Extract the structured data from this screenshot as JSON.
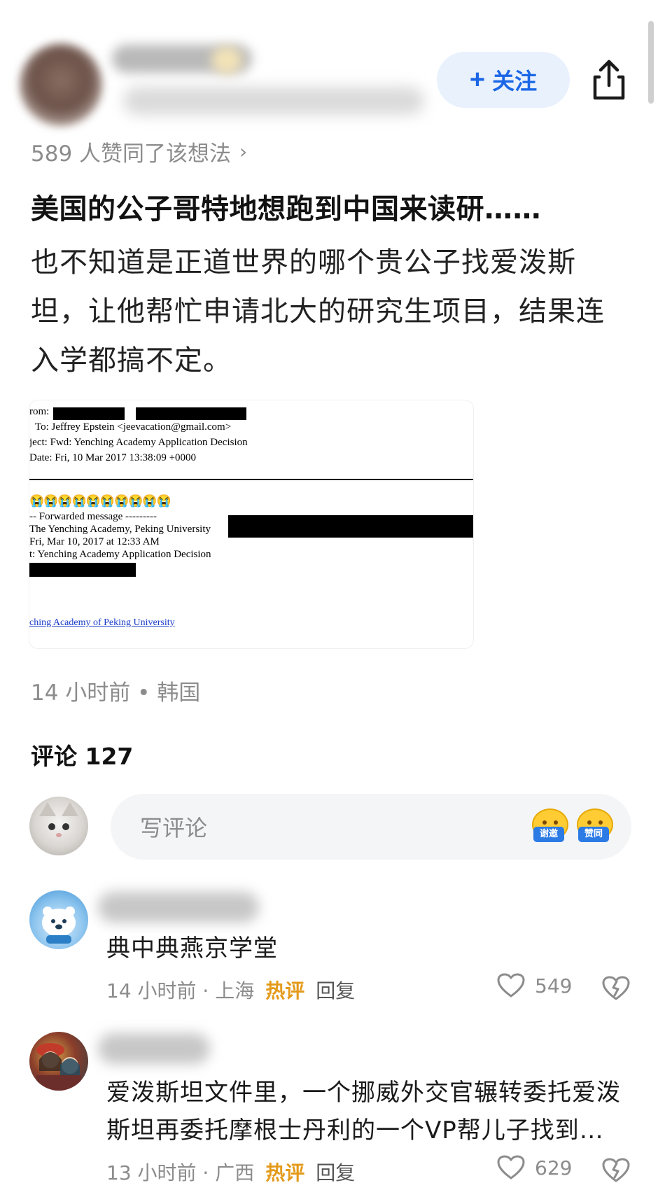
{
  "header": {
    "follow_label": "关注",
    "follow_plus": "+"
  },
  "post": {
    "likes_text": "589 人赞同了该想法",
    "likes_chevron": "›",
    "title": "美国的公子哥特地想跑到中国来读研……",
    "body": "也不知道是正道世界的哪个贵公子找爱泼斯坦，让他帮忙申请北大的研究生项目，结果连入学都搞不定。",
    "meta": "14 小时前 • 韩国",
    "email": {
      "from_label": "rom:",
      "to_line": "To: Jeffrey Epstein <jeevacation@gmail.com>",
      "subject_line": "ject: Fwd: Yenching Academy Application Decision",
      "date_line": "Date: Fri, 10 Mar 2017 13:38:09 +0000",
      "emojis": "😭😭😭😭😭😭😭😭😭😭",
      "forwarded_line": "-- Forwarded message ---------",
      "fwd_from_line": "The Yenching Academy, Peking University",
      "fwd_date_line": "Fri, Mar 10, 2017 at 12:33 AM",
      "fwd_subject_line": "t: Yenching Academy Application Decision",
      "link_text": "ching Academy of Peking University"
    }
  },
  "comments": {
    "title": "评论 127",
    "composer_placeholder": "写评论",
    "composer_emoji_1": "谢邀",
    "composer_emoji_2": "赞同",
    "items": [
      {
        "text": "典中典燕京学堂",
        "time_loc": "14 小时前 · 上海",
        "hot_label": "热评",
        "reply_label": "回复",
        "likes": "549"
      },
      {
        "text": "爱泼斯坦文件里，一个挪威外交官辗转委托爱泼斯坦再委托摩根士丹利的一个VP帮儿子找到…",
        "time_loc": "13 小时前 · 广西",
        "hot_label": "热评",
        "reply_label": "回复",
        "likes": "629"
      }
    ]
  },
  "colors": {
    "accent": "#1a66e6",
    "follow_bg": "#e9f1fd",
    "hot": "#e39a1a",
    "muted": "#8c8c8c"
  },
  "icons": [
    "share-icon",
    "heart-icon",
    "dislike-heart-icon",
    "chevron-right-icon"
  ]
}
